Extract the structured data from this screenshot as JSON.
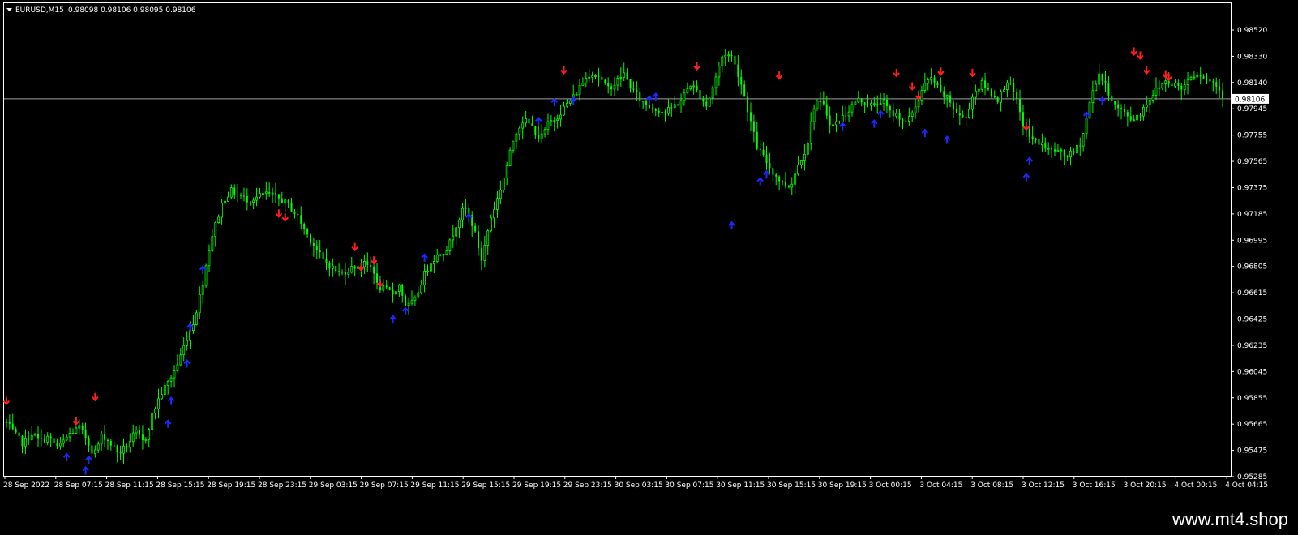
{
  "header": {
    "symbol": "EURUSD,M15",
    "ohlc": "0.98098 0.98106 0.98095 0.98106"
  },
  "watermark": "www.mt4.shop",
  "colors": {
    "background": "#000000",
    "frame": "#ffffff",
    "candles": "#00ff00",
    "buy_arrow": "#1e28ff",
    "sell_arrow": "#ff1e1e",
    "price_line": "#a0a0a0",
    "price_tag_bg": "#ffffff",
    "price_tag_text": "#000000"
  },
  "chart_data": {
    "type": "candlestick",
    "ylim": [
      0.95285,
      0.9862
    ],
    "current_price": "0.98106",
    "current_price_value": 0.98106,
    "price_ticks": [
      "0.98520",
      "0.98330",
      "0.98140",
      "0.97945",
      "0.97755",
      "0.97565",
      "0.97375",
      "0.97185",
      "0.96995",
      "0.96805",
      "0.96615",
      "0.96425",
      "0.96235",
      "0.96045",
      "0.95855",
      "0.95665",
      "0.95475",
      "0.95285"
    ],
    "time_ticks": [
      "28 Sep 2022",
      "28 Sep 07:15",
      "28 Sep 11:15",
      "28 Sep 15:15",
      "28 Sep 19:15",
      "28 Sep 23:15",
      "29 Sep 03:15",
      "29 Sep 07:15",
      "29 Sep 11:15",
      "29 Sep 15:15",
      "29 Sep 19:15",
      "29 Sep 23:15",
      "30 Sep 03:15",
      "30 Sep 07:15",
      "30 Sep 11:15",
      "30 Sep 15:15",
      "30 Sep 19:15",
      "3 Oct 00:15",
      "3 Oct 04:15",
      "3 Oct 08:15",
      "3 Oct 12:15",
      "3 Oct 16:15",
      "3 Oct 20:15",
      "4 Oct 00:15",
      "4 Oct 04:15"
    ],
    "bars_total": 385,
    "price_path": [
      [
        0,
        0.9569
      ],
      [
        4,
        0.956
      ],
      [
        8,
        0.9553
      ],
      [
        12,
        0.9561
      ],
      [
        16,
        0.9555
      ],
      [
        20,
        0.9558
      ],
      [
        25,
        0.955
      ],
      [
        30,
        0.956
      ],
      [
        35,
        0.9565
      ],
      [
        38,
        0.9558
      ],
      [
        42,
        0.9545
      ],
      [
        46,
        0.956
      ],
      [
        50,
        0.9553
      ],
      [
        54,
        0.9546
      ],
      [
        58,
        0.9552
      ],
      [
        62,
        0.9562
      ],
      [
        66,
        0.9553
      ],
      [
        70,
        0.9575
      ],
      [
        74,
        0.959
      ],
      [
        78,
        0.96
      ],
      [
        82,
        0.9612
      ],
      [
        86,
        0.963
      ],
      [
        90,
        0.9645
      ],
      [
        94,
        0.9672
      ],
      [
        98,
        0.9705
      ],
      [
        102,
        0.9725
      ],
      [
        104,
        0.9735
      ],
      [
        108,
        0.9742
      ],
      [
        112,
        0.9738
      ],
      [
        116,
        0.9735
      ],
      [
        120,
        0.9737
      ],
      [
        124,
        0.974
      ],
      [
        128,
        0.9738
      ],
      [
        132,
        0.9735
      ],
      [
        136,
        0.973
      ],
      [
        140,
        0.9722
      ],
      [
        144,
        0.971
      ],
      [
        148,
        0.97
      ],
      [
        152,
        0.969
      ],
      [
        156,
        0.9685
      ],
      [
        160,
        0.968
      ],
      [
        164,
        0.9683
      ],
      [
        168,
        0.9686
      ],
      [
        172,
        0.9687
      ],
      [
        176,
        0.9684
      ],
      [
        178,
        0.967
      ],
      [
        182,
        0.9668
      ],
      [
        186,
        0.9665
      ],
      [
        188,
        0.9673
      ],
      [
        192,
        0.9655
      ],
      [
        196,
        0.966
      ],
      [
        200,
        0.9678
      ],
      [
        204,
        0.969
      ],
      [
        208,
        0.9695
      ],
      [
        212,
        0.97
      ],
      [
        216,
        0.9718
      ],
      [
        220,
        0.973
      ],
      [
        224,
        0.9715
      ],
      [
        228,
        0.969
      ],
      [
        232,
        0.972
      ],
      [
        236,
        0.9738
      ],
      [
        240,
        0.976
      ],
      [
        244,
        0.9785
      ],
      [
        248,
        0.9795
      ],
      [
        252,
        0.979
      ],
      [
        256,
        0.978
      ],
      [
        260,
        0.9792
      ],
      [
        264,
        0.9797
      ],
      [
        268,
        0.9805
      ],
      [
        272,
        0.9812
      ],
      [
        276,
        0.9822
      ],
      [
        280,
        0.983
      ],
      [
        284,
        0.9828
      ],
      [
        288,
        0.9818
      ],
      [
        292,
        0.9822
      ],
      [
        296,
        0.983
      ],
      [
        300,
        0.9818
      ],
      [
        304,
        0.981
      ],
      [
        308,
        0.9805
      ],
      [
        312,
        0.9803
      ],
      [
        316,
        0.98
      ],
      [
        320,
        0.9805
      ],
      [
        324,
        0.981
      ],
      [
        328,
        0.9822
      ],
      [
        332,
        0.9815
      ],
      [
        336,
        0.9805
      ],
      [
        340,
        0.9825
      ],
      [
        344,
        0.9845
      ],
      [
        348,
        0.9842
      ],
      [
        352,
        0.9825
      ],
      [
        356,
        0.98
      ],
      [
        360,
        0.9775
      ],
      [
        364,
        0.9765
      ],
      [
        368,
        0.9755
      ],
      [
        372,
        0.9748
      ],
      [
        376,
        0.9745
      ],
      [
        380,
        0.9762
      ],
      [
        384,
        0.9775
      ],
      [
        388,
        0.981
      ],
      [
        392,
        0.9805
      ],
      [
        396,
        0.979
      ],
      [
        400,
        0.9795
      ],
      [
        404,
        0.9802
      ],
      [
        408,
        0.981
      ],
      [
        412,
        0.9808
      ],
      [
        416,
        0.9805
      ],
      [
        420,
        0.981
      ],
      [
        424,
        0.98
      ],
      [
        428,
        0.9798
      ],
      [
        432,
        0.9792
      ],
      [
        436,
        0.9805
      ],
      [
        440,
        0.982
      ],
      [
        444,
        0.9826
      ],
      [
        448,
        0.9815
      ],
      [
        452,
        0.981
      ],
      [
        456,
        0.98
      ],
      [
        460,
        0.9795
      ],
      [
        464,
        0.9815
      ],
      [
        468,
        0.9822
      ],
      [
        472,
        0.9815
      ],
      [
        476,
        0.981
      ],
      [
        480,
        0.9825
      ],
      [
        484,
        0.9812
      ],
      [
        488,
        0.979
      ],
      [
        492,
        0.978
      ],
      [
        496,
        0.9778
      ],
      [
        500,
        0.9772
      ],
      [
        504,
        0.9772
      ],
      [
        508,
        0.9768
      ],
      [
        512,
        0.977
      ],
      [
        516,
        0.978
      ],
      [
        520,
        0.981
      ],
      [
        524,
        0.983
      ],
      [
        528,
        0.9818
      ],
      [
        532,
        0.9805
      ],
      [
        536,
        0.98
      ],
      [
        540,
        0.9795
      ],
      [
        544,
        0.98
      ],
      [
        548,
        0.981
      ],
      [
        552,
        0.9818
      ],
      [
        556,
        0.9824
      ],
      [
        560,
        0.9822
      ],
      [
        564,
        0.9818
      ],
      [
        568,
        0.9828
      ],
      [
        572,
        0.983
      ],
      [
        576,
        0.9825
      ],
      [
        580,
        0.9822
      ],
      [
        585,
        0.981
      ]
    ],
    "sell_signals": [
      [
        0,
        0.9585
      ],
      [
        22,
        0.957
      ],
      [
        28,
        0.9588
      ],
      [
        86,
        0.9725
      ],
      [
        88,
        0.9722
      ],
      [
        110,
        0.97
      ],
      [
        112,
        0.9685
      ],
      [
        116,
        0.969
      ],
      [
        118,
        0.9673
      ],
      [
        176,
        0.9832
      ],
      [
        218,
        0.9835
      ],
      [
        244,
        0.9828
      ],
      [
        281,
        0.983
      ],
      [
        286,
        0.982
      ],
      [
        288,
        0.9813
      ],
      [
        295,
        0.9831
      ],
      [
        305,
        0.983
      ],
      [
        322,
        0.979
      ],
      [
        356,
        0.9846
      ],
      [
        358,
        0.9843
      ],
      [
        360,
        0.9832
      ],
      [
        366,
        0.9829
      ],
      [
        367,
        0.9827
      ]
    ],
    "buy_signals": [
      [
        19,
        0.9543
      ],
      [
        25,
        0.9533
      ],
      [
        26,
        0.9541
      ],
      [
        51,
        0.9568
      ],
      [
        52,
        0.9585
      ],
      [
        57,
        0.9613
      ],
      [
        58,
        0.964
      ],
      [
        62,
        0.9683
      ],
      [
        122,
        0.9646
      ],
      [
        126,
        0.9652
      ],
      [
        132,
        0.9692
      ],
      [
        146,
        0.9722
      ],
      [
        168,
        0.9794
      ],
      [
        173,
        0.9808
      ],
      [
        179,
        0.9809
      ],
      [
        203,
        0.981
      ],
      [
        205,
        0.9812
      ],
      [
        229,
        0.9716
      ],
      [
        238,
        0.9749
      ],
      [
        240,
        0.9754
      ],
      [
        264,
        0.979
      ],
      [
        274,
        0.9792
      ],
      [
        276,
        0.9799
      ],
      [
        290,
        0.9785
      ],
      [
        297,
        0.978
      ],
      [
        322,
        0.9752
      ],
      [
        323,
        0.9764
      ],
      [
        341,
        0.9798
      ],
      [
        346,
        0.9809
      ]
    ]
  }
}
